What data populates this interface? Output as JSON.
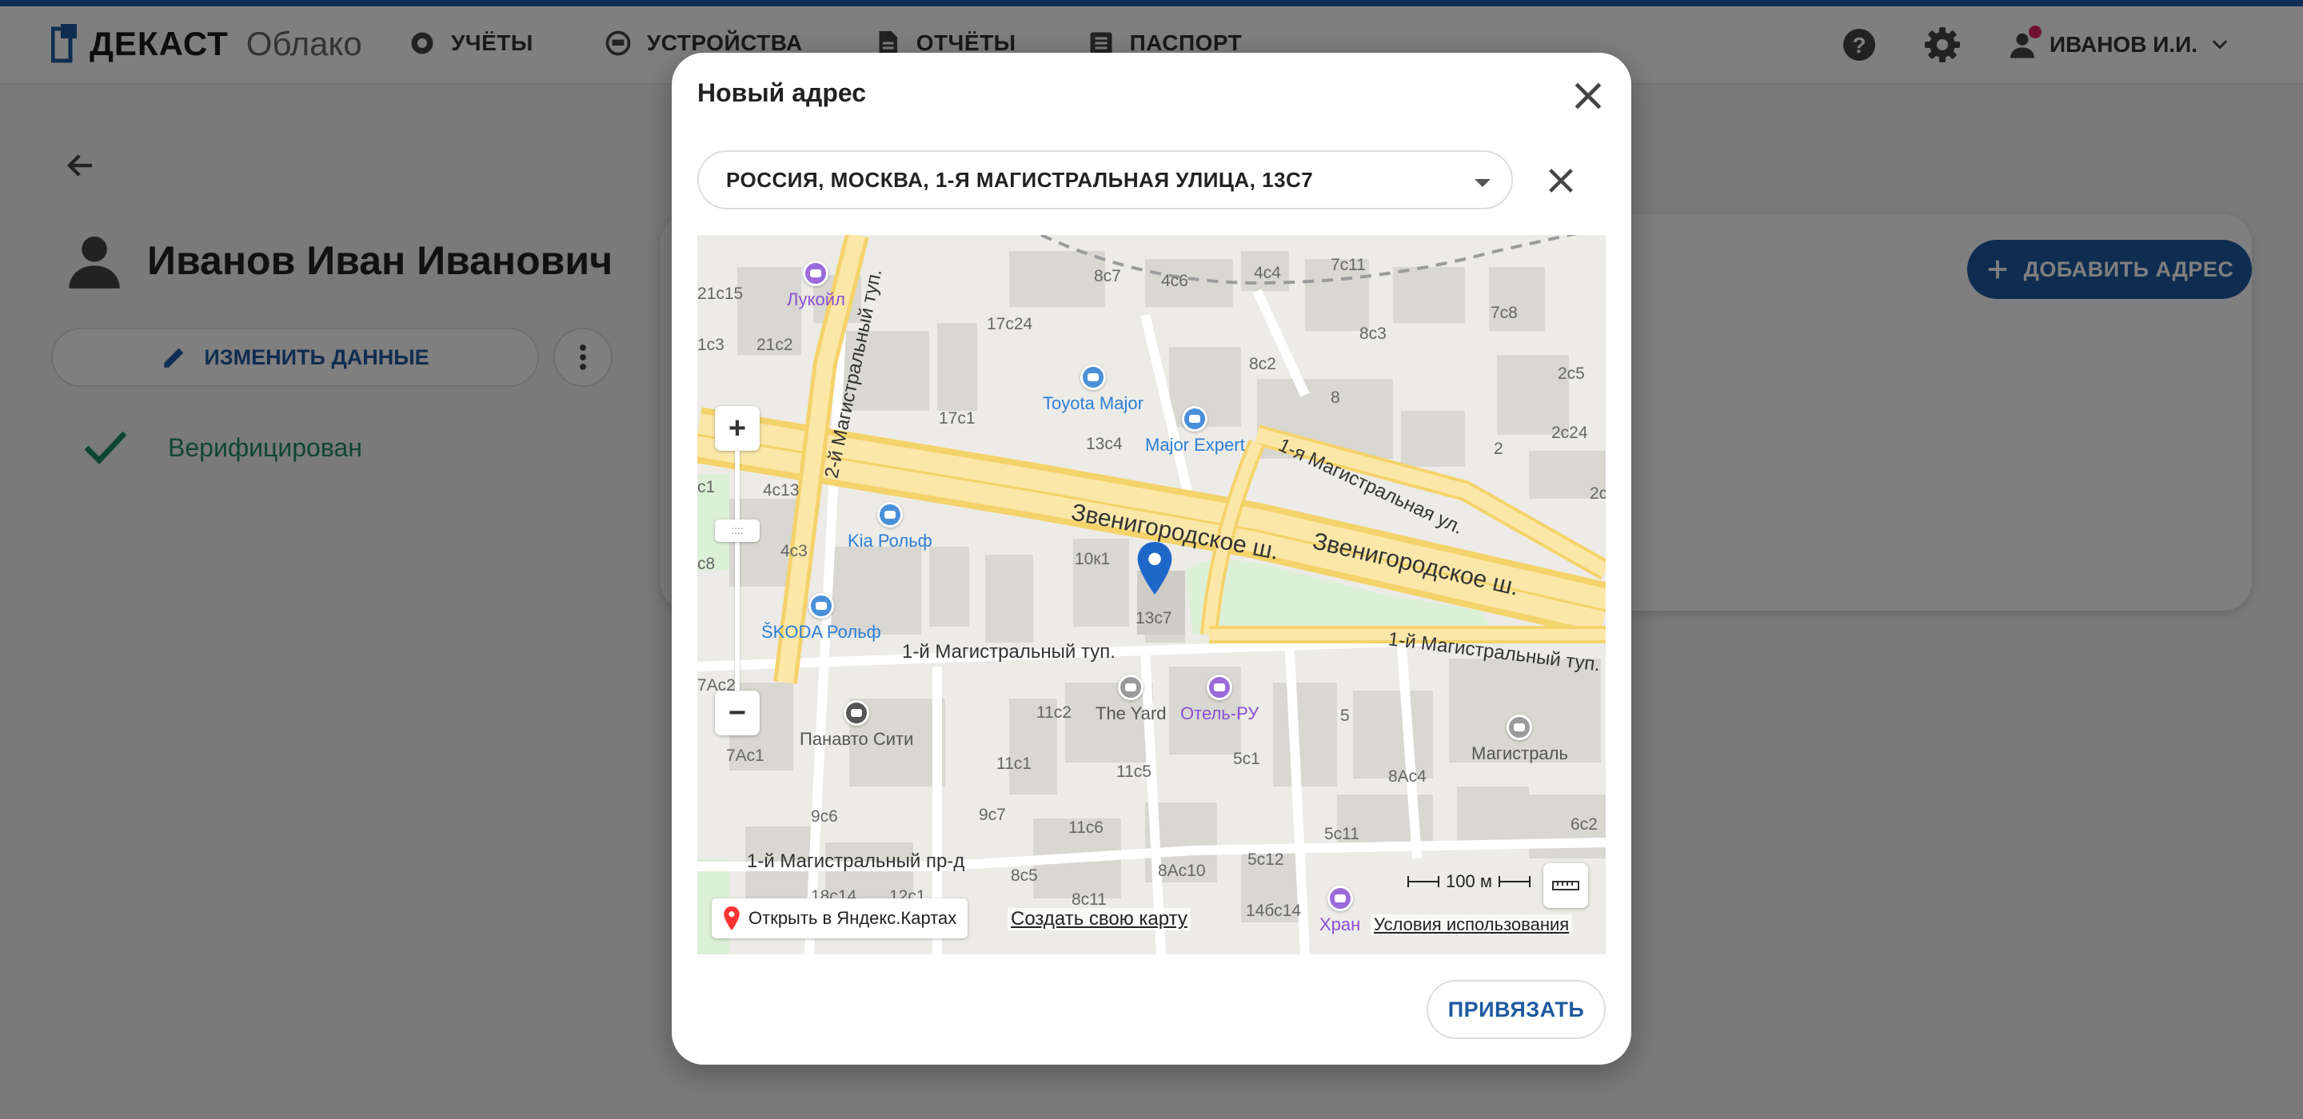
{
  "app": {
    "brand": "ДЕКАСТ",
    "brand_sub": "Облако"
  },
  "nav": [
    {
      "label": "УЧЁТЫ",
      "icon": "gear-circle-icon"
    },
    {
      "label": "УСТРОЙСТВА",
      "icon": "meter-icon"
    },
    {
      "label": "ОТЧЁТЫ",
      "icon": "document-icon"
    },
    {
      "label": "ПАСПОРТ",
      "icon": "list-icon"
    }
  ],
  "user": {
    "name": "ИВАНОВ И.И."
  },
  "profile": {
    "full_name": "Иванов Иван Иванович",
    "edit_label": "ИЗМЕНИТЬ ДАННЫЕ",
    "status": "Верифицирован"
  },
  "addresses": {
    "add_label": "ДОБАВИТЬ АДРЕС"
  },
  "dialog": {
    "title": "Новый адрес",
    "address_value": "РОССИЯ, МОСКВА, 1-Я МАГИСТРАЛЬНАЯ УЛИЦА, 13С7",
    "submit_label": "ПРИВЯЗАТЬ"
  },
  "map": {
    "open_in": "Открыть в Яндекс.Картах",
    "create_map": "Создать свою карту",
    "terms": "Условия использования",
    "scale": "100 м",
    "roads": {
      "zvenigorodskoe_1": "Звенигородское ш.",
      "zvenigorodskoe_2": "Звенигородское ш.",
      "magistralnaya_1": "1-я Магистральная ул.",
      "tup_2": "2-й Магистральный туп.",
      "tup_1_left": "1-й Магистральный туп.",
      "tup_1_right": "1-й Магистральный туп.",
      "proezd_1": "1-й Магистральный пр-д"
    },
    "pois": {
      "lukoil": "Лукойл",
      "toyota": "Toyota Major",
      "major_expert": "Major Expert",
      "kia": "Kia Рольф",
      "skoda": "ŠKODA Рольф",
      "panavto": "Панавто Сити",
      "yard": "The Yard",
      "hotel": "Отель-РУ",
      "magistral": "Магистраль",
      "hran": "Хран"
    },
    "house_numbers": [
      "21с15",
      "21с2",
      "1с3",
      "17с24",
      "8с7",
      "4с6",
      "4с4",
      "7с11",
      "7с8",
      "8с3",
      "8с2",
      "8",
      "2с5",
      "2с24",
      "2",
      "2с",
      "17с1",
      "13с4",
      "4с13",
      "с1",
      "4с3",
      "10к1",
      "13с7",
      "с8",
      "7Ас2",
      "11с2",
      "7Ас1",
      "11с1",
      "11с5",
      "5с1",
      "5",
      "8Ас4",
      "6с2",
      "9с6",
      "9с7",
      "11с6",
      "5с11",
      "8с5",
      "8Ас10",
      "5с12",
      "8с11",
      "14бс14",
      "18с14",
      "12с1"
    ]
  }
}
